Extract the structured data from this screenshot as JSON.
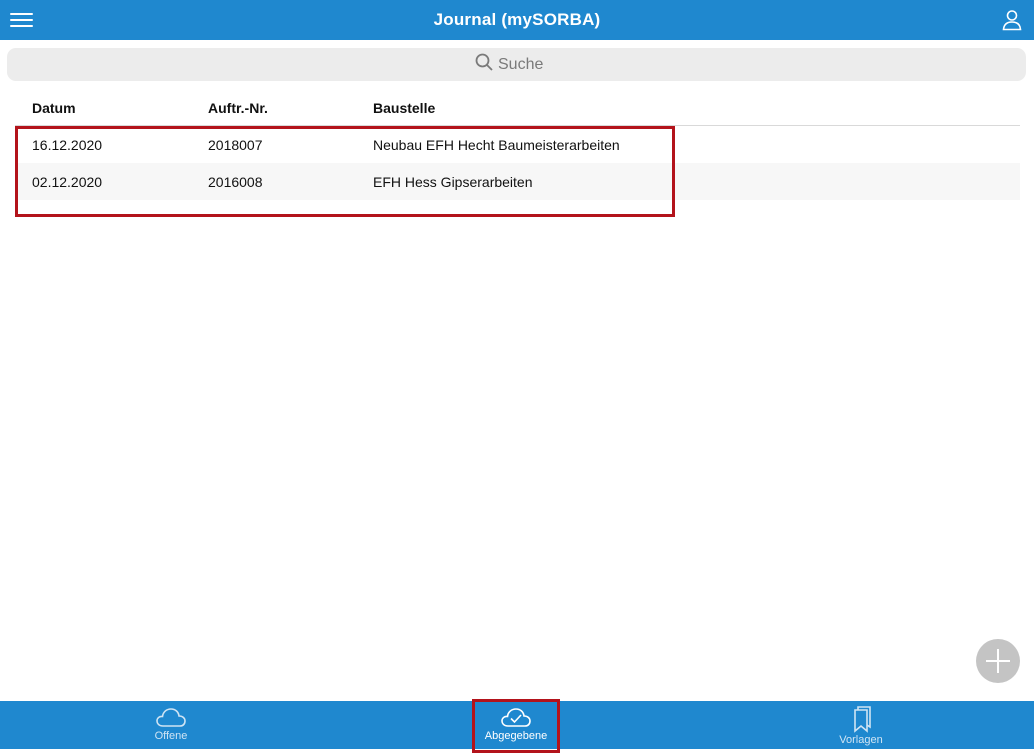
{
  "header": {
    "title": "Journal (mySORBA)",
    "icons": {
      "menu": "hamburger-menu-icon",
      "user": "user-icon"
    }
  },
  "search": {
    "placeholder": "Suche",
    "value": "",
    "icon": "search-icon"
  },
  "table": {
    "columns": [
      "Datum",
      "Auftr.-Nr.",
      "Baustelle"
    ],
    "rows": [
      [
        "16.12.2020",
        "2018007",
        "Neubau EFH Hecht Baumeisterarbeiten"
      ],
      [
        "02.12.2020",
        "2016008",
        "EFH Hess Gipserarbeiten"
      ]
    ]
  },
  "fab": {
    "icon": "plus-icon"
  },
  "tabs": [
    {
      "label": "Offene",
      "icon": "cloud-icon",
      "active": false
    },
    {
      "label": "Abgegebene",
      "icon": "cloud-check-icon",
      "active": true
    },
    {
      "label": "Vorlagen",
      "icon": "bookmarks-icon",
      "active": false
    }
  ],
  "colors": {
    "primary": "#1f88cf",
    "highlight": "#b3131b",
    "search_bg": "#ececec",
    "fab": "#c4c4c4"
  }
}
